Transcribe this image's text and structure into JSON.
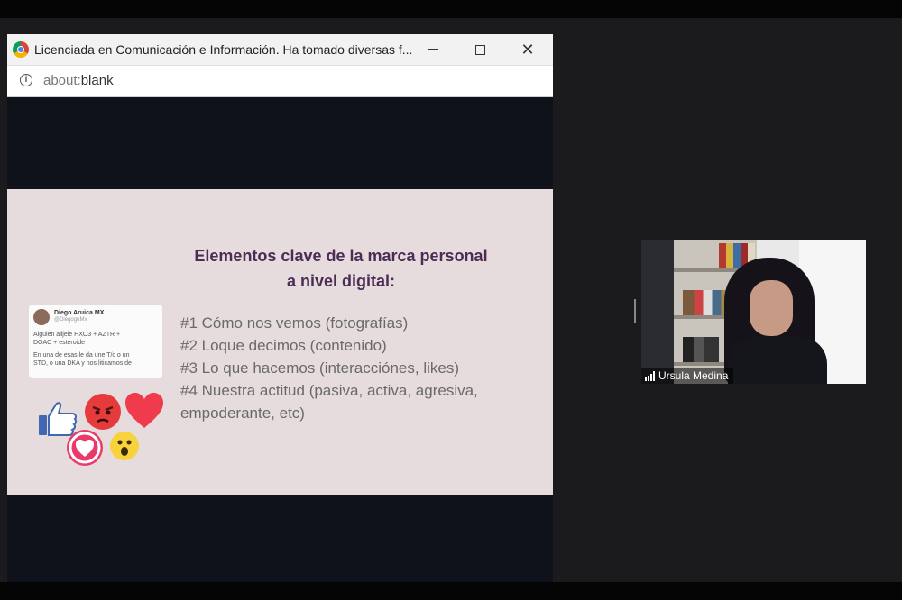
{
  "browser": {
    "title": "Licenciada en Comunicación e Información. Ha tomado diversas f...",
    "url_dim": "about:",
    "url_main": "blank",
    "minimize_label": "–",
    "maximize_label": "☐",
    "close_label": "✕"
  },
  "slide": {
    "title_line_1": "Elementos clave de la marca personal",
    "title_line_2": "a nivel digital:",
    "items": [
      "#1 Cómo nos vemos (fotografías)",
      "#2 Loque decimos (contenido)",
      "#3 Lo que hacemos (interacciónes, likes)",
      "#4 Nuestra actitud (pasiva, activa, agresiva, empoderante, etc)"
    ],
    "tweet": {
      "name": "Diego Aruica MX",
      "handle": "@DiegoguMx",
      "line_1": "Alguien alijele HXO3 + AZTR +",
      "line_2": "DOAC + esteroide",
      "line_3": "En una de esas le da une T/c o un",
      "line_4": "STD, o una DKA y nos liticamos de"
    },
    "reactions": [
      "like-icon",
      "angry-icon",
      "heart-icon",
      "love-icon",
      "wow-icon"
    ]
  },
  "video": {
    "participant_name": "Ursula Medina"
  },
  "colors": {
    "slide_bg": "#e7dcdd",
    "title": "#4a2c55",
    "text": "#6a6a6a",
    "stage_bg": "#1b1b1d"
  }
}
